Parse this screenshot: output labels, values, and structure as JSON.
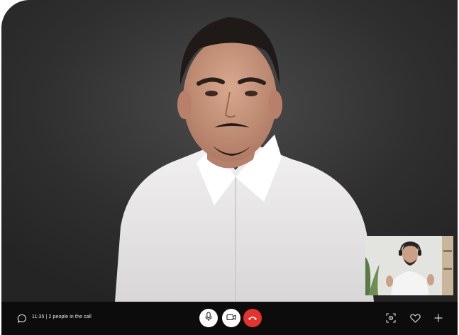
{
  "call": {
    "time": "11:35",
    "participants_text": "2 people in the call",
    "info_text": "11:35 | 2 people in the call"
  },
  "controls": {
    "microphone": "microphone-icon",
    "camera": "video-camera-icon",
    "end_call": "phone-hangup-icon",
    "focus": "focus-camera-icon",
    "favorite": "heart-icon",
    "add": "plus-icon"
  },
  "colors": {
    "bar_background": "#0c0c0c",
    "end_call": "#e5322d",
    "button": "#ffffff"
  }
}
